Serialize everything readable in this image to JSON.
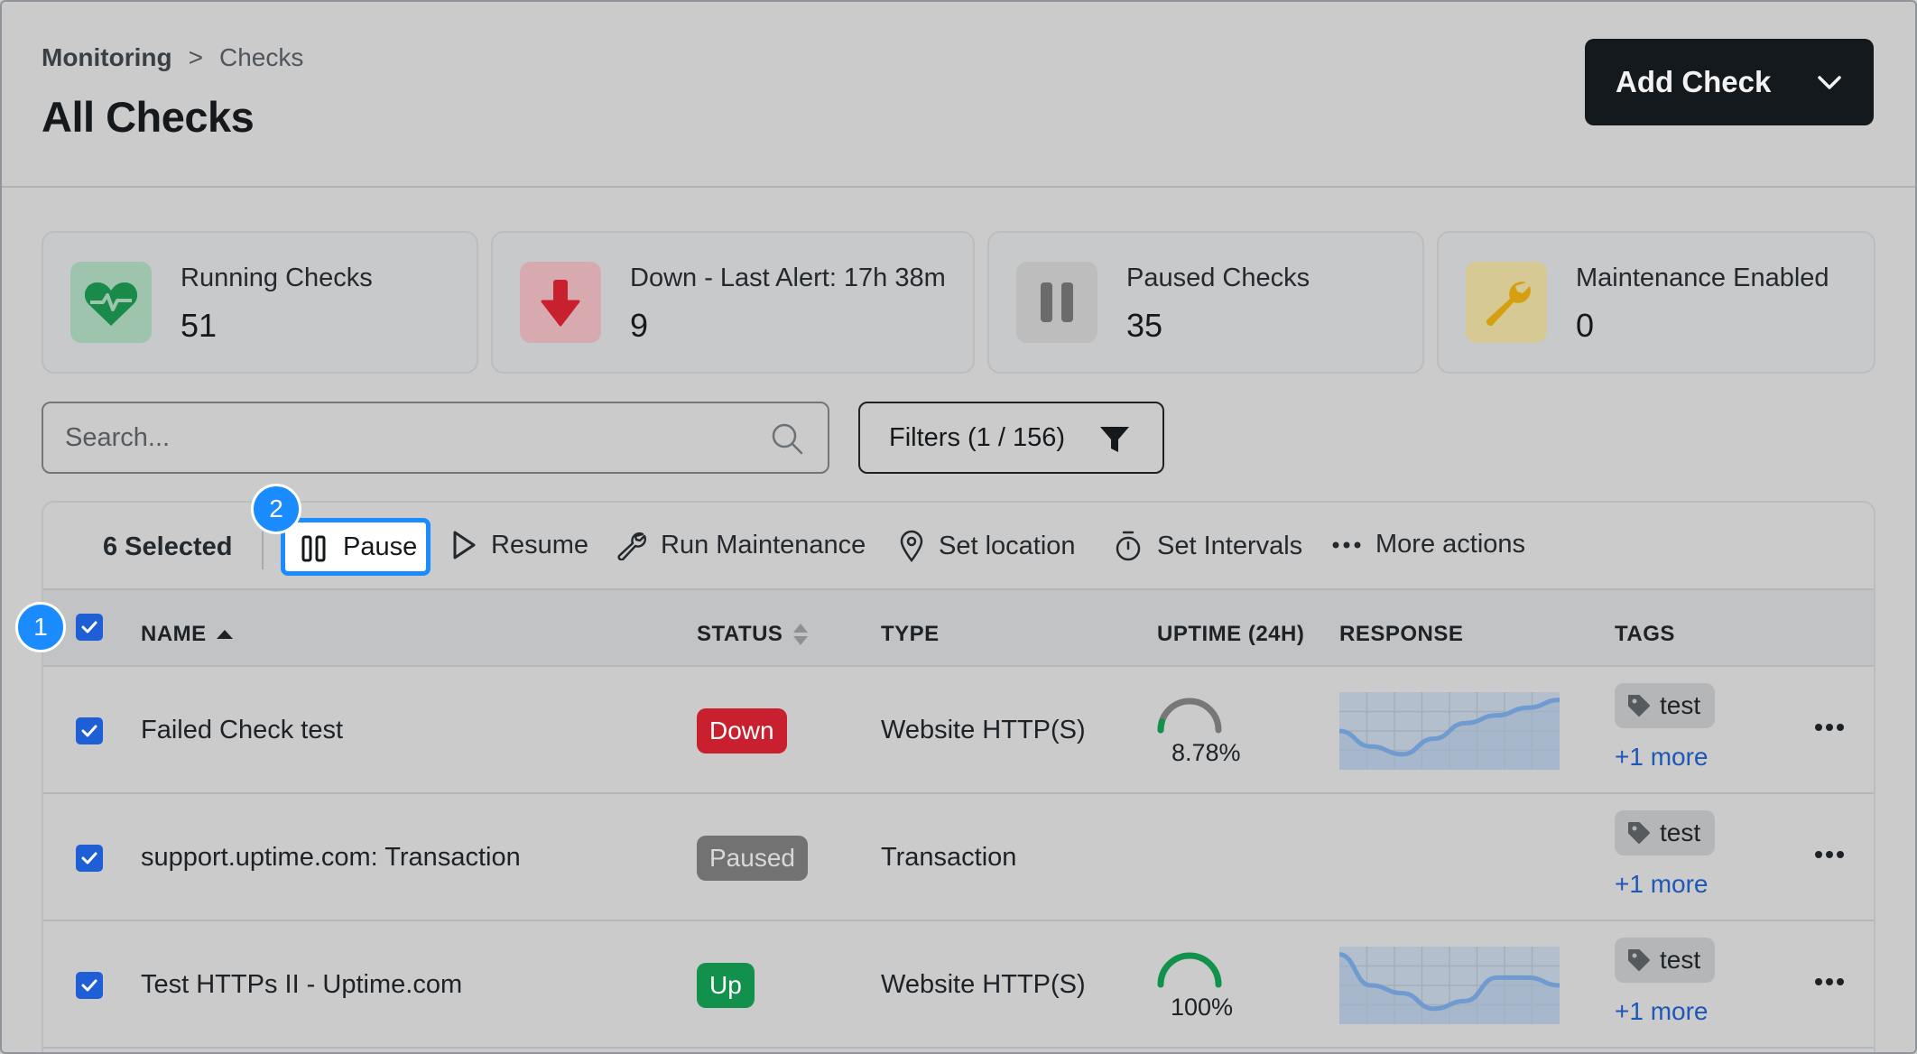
{
  "breadcrumb": {
    "root": "Monitoring",
    "separator": ">",
    "current": "Checks"
  },
  "page_title": "All Checks",
  "add_check_label": "Add Check",
  "stats": [
    {
      "label": "Running Checks",
      "value": "51",
      "icon": "heartbeat-icon",
      "color": "#1a8a4a"
    },
    {
      "label": "Down - Last Alert: 17h 38m",
      "value": "9",
      "icon": "arrow-down-icon",
      "color": "#c8202f"
    },
    {
      "label": "Paused Checks",
      "value": "35",
      "icon": "pause-icon",
      "color": "#6b6b6b"
    },
    {
      "label": "Maintenance Enabled",
      "value": "0",
      "icon": "wrench-icon",
      "color": "#d4a012"
    }
  ],
  "search": {
    "placeholder": "Search...",
    "value": ""
  },
  "filters_label": "Filters (1 / 156)",
  "bulk": {
    "selected": "6 Selected",
    "pause": "Pause",
    "resume": "Resume",
    "run_maintenance": "Run Maintenance",
    "set_location": "Set location",
    "set_intervals": "Set Intervals",
    "more_actions": "More actions"
  },
  "columns": {
    "name": "NAME",
    "status": "STATUS",
    "type": "TYPE",
    "uptime": "UPTIME (24H)",
    "response": "RESPONSE",
    "tags": "TAGS"
  },
  "rows": [
    {
      "name": "Failed Check test",
      "status": "Down",
      "status_color": "#c8202f",
      "type": "Website HTTP(S)",
      "uptime": "8.78%",
      "uptime_fraction": 0.0878,
      "response": [
        5,
        3,
        2,
        4,
        6,
        7,
        8,
        9
      ],
      "tag": "test",
      "more_tags": "+1 more"
    },
    {
      "name": "support.uptime.com: Transaction",
      "status": "Paused",
      "status_color": "#727272",
      "type": "Transaction",
      "uptime": "",
      "response": [],
      "tag": "test",
      "more_tags": "+1 more"
    },
    {
      "name": "Test HTTPs II - Uptime.com",
      "status": "Up",
      "status_color": "#12914d",
      "type": "Website HTTP(S)",
      "uptime": "100%",
      "uptime_fraction": 1.0,
      "response": [
        9,
        5,
        4,
        2,
        3,
        6,
        6,
        5
      ],
      "tag": "test",
      "more_tags": "+1 more"
    }
  ],
  "step_markers": [
    "1",
    "2"
  ],
  "colors": {
    "accent": "#1a8cff",
    "checkbox": "#1f5fd6",
    "link": "#1d57b8",
    "button_dark": "#14191e"
  }
}
